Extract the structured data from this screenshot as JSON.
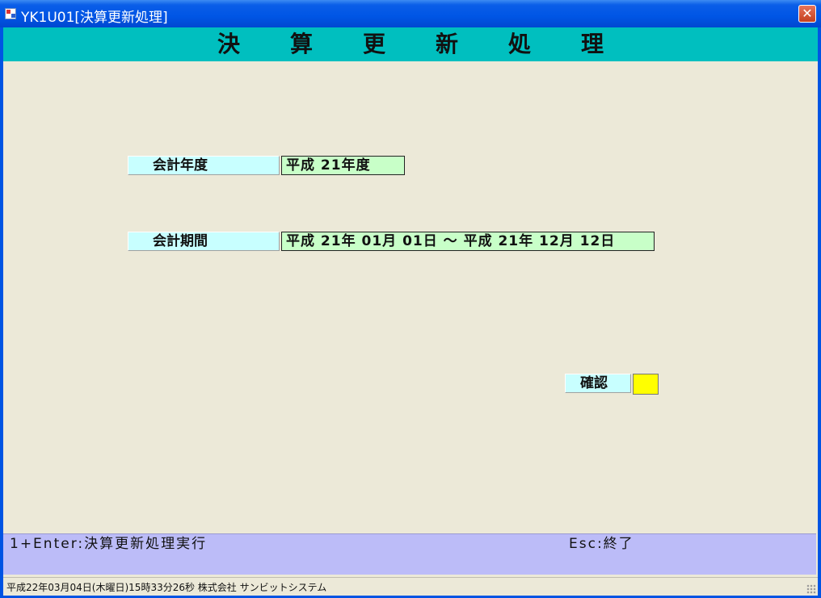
{
  "window": {
    "title": "YK1U01[決算更新処理]",
    "close_glyph": "✕"
  },
  "header": {
    "title": "決算更新処理"
  },
  "form": {
    "fiscal_year_label": "会計年度",
    "fiscal_year_value": "平成 21年度",
    "fiscal_period_label": "会計期間",
    "fiscal_period_value": "平成 21年 01月 01日 〜 平成 21年 12月 12日",
    "confirm_label": "確認"
  },
  "footer": {
    "left_hint": "1+Enter:決算更新処理実行",
    "right_hint": "Esc:終了"
  },
  "statusbar": {
    "text": "平成22年03月04日(木曜日)15時33分26秒  株式会社 サンビットシステム"
  },
  "colors": {
    "header_band": "#00bfbf",
    "label_bg": "#c8ffff",
    "value_bg": "#c8ffc8",
    "confirm_input": "#ffff00",
    "footer_band": "#bcbcf8",
    "client_bg": "#ece9d8"
  },
  "icons": {
    "app": "app-icon",
    "close": "close-icon"
  }
}
